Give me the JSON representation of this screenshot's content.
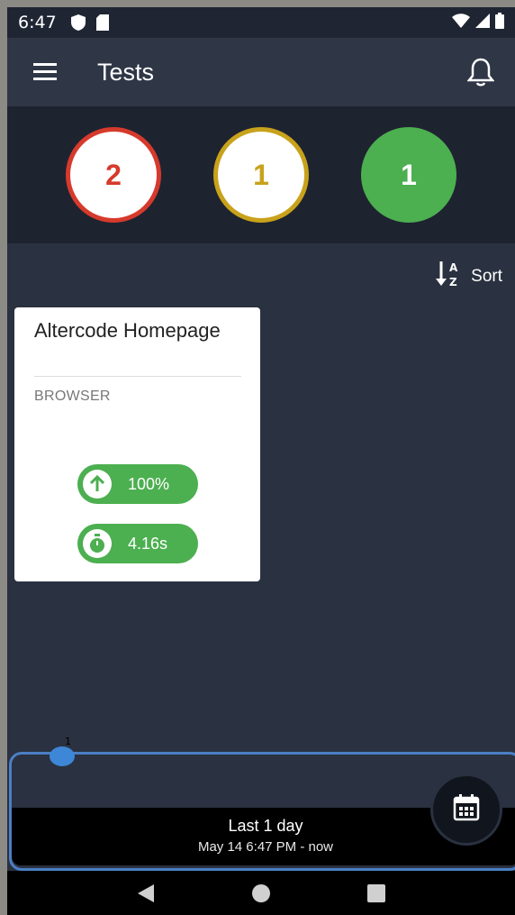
{
  "status_bar": {
    "time": "6:47",
    "icons": [
      "shield-icon",
      "sd-card-icon",
      "wifi-icon",
      "signal-icon",
      "battery-icon"
    ]
  },
  "app_bar": {
    "title": "Tests",
    "menu_icon": "hamburger-menu-icon",
    "bell_icon": "notification-bell-icon"
  },
  "summary": {
    "failed_count": "2",
    "warning_count": "1",
    "passed_count": "1",
    "colors": {
      "failed": "#d63a2c",
      "warning": "#c8a21a",
      "passed": "#4caf50"
    }
  },
  "sort": {
    "label": "Sort",
    "icon": "sort-az-icon"
  },
  "cards": [
    {
      "title": "Altercode Homepage",
      "type": "BROWSER",
      "success_rate": "100%",
      "duration": "4.16s"
    }
  ],
  "timeline": {
    "handle_label": "1",
    "range_label": "Last 1 day",
    "range_detail": "May 14 6:47 PM - now",
    "calendar_icon": "calendar-icon"
  },
  "nav_bar": {
    "icons": [
      "back-icon",
      "home-icon",
      "recents-icon"
    ]
  }
}
